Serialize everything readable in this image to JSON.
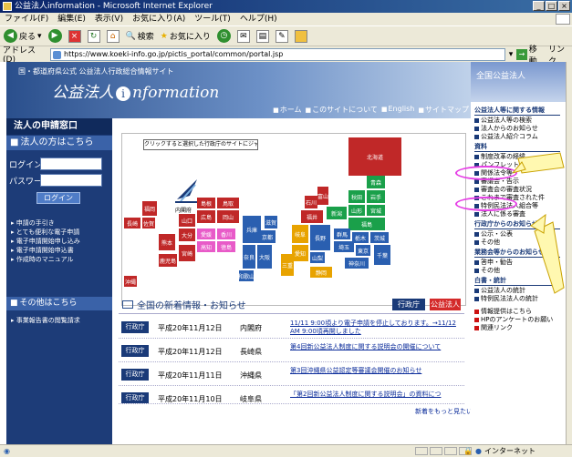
{
  "window": {
    "title": "公益法人information - Microsoft Internet Explorer",
    "controls": [
      "_",
      "□",
      "×"
    ]
  },
  "menu": [
    "ファイル(F)",
    "編集(E)",
    "表示(V)",
    "お気に入り(A)",
    "ツール(T)",
    "ヘルプ(H)"
  ],
  "toolbar": {
    "back": "戻る",
    "search": "検索",
    "favorites": "お気に入り"
  },
  "address": {
    "label": "アドレス(D)",
    "url": "https://www.koeki-info.go.jp/pictis_portal/common/portal.jsp",
    "go": "移動",
    "links": "リンク"
  },
  "header": {
    "subtitle": "国・都道府県公式 公益法人行政総合情報サイト",
    "logo_prefix": "公益法人",
    "logo_mark": "i",
    "logo_suffix": "nformation",
    "nav": [
      "ホーム",
      "このサイトについて",
      "English",
      "サイトマップ"
    ]
  },
  "left": {
    "title": "法人の申請窓口",
    "section": "法人の方はこちら",
    "login_id_label": "ログインID",
    "password_label": "パスワード",
    "login_button": "ログイン",
    "links": [
      "申請の手引き",
      "とても便利な電子申請",
      "電子申請開始申し込み",
      "電子申請開始申込書",
      "作成時のマニュアル"
    ],
    "other_section": "その他はこちら",
    "other_links": [
      "事業報告書の閲覧請求"
    ]
  },
  "map": {
    "hint": "クリックすると選択した行政庁のサイトにジャンプします",
    "cabinet_label": "内閣府",
    "prefectures": [
      {
        "name": "北海道",
        "color": "#c02828"
      },
      {
        "name": "青森",
        "color": "#1aa04a"
      },
      {
        "name": "秋田",
        "color": "#1aa04a"
      },
      {
        "name": "岩手",
        "color": "#1aa04a"
      },
      {
        "name": "山形",
        "color": "#1aa04a"
      },
      {
        "name": "宮城",
        "color": "#1aa04a"
      },
      {
        "name": "石川",
        "color": "#c02828"
      },
      {
        "name": "新潟",
        "color": "#1aa04a"
      },
      {
        "name": "福島",
        "color": "#1aa04a"
      },
      {
        "name": "富山",
        "color": "#c02828"
      },
      {
        "name": "福井",
        "color": "#c02828"
      },
      {
        "name": "長野",
        "color": "#2a5fb0"
      },
      {
        "name": "群馬",
        "color": "#2a5fb0"
      },
      {
        "name": "栃木",
        "color": "#2a5fb0"
      },
      {
        "name": "茨城",
        "color": "#2a5fb0"
      },
      {
        "name": "埼玉",
        "color": "#2a5fb0"
      },
      {
        "name": "東京",
        "color": "#2a5fb0"
      },
      {
        "name": "千葉",
        "color": "#2a5fb0"
      },
      {
        "name": "神奈川",
        "color": "#2a5fb0"
      },
      {
        "name": "山梨",
        "color": "#2a5fb0"
      },
      {
        "name": "岐阜",
        "color": "#e8a300"
      },
      {
        "name": "静岡",
        "color": "#e8a300"
      },
      {
        "name": "愛知",
        "color": "#e8a300"
      },
      {
        "name": "三重",
        "color": "#e8a300"
      },
      {
        "name": "滋賀",
        "color": "#2a5fb0"
      },
      {
        "name": "京都",
        "color": "#2a5fb0"
      },
      {
        "name": "大阪",
        "color": "#2a5fb0"
      },
      {
        "name": "兵庫",
        "color": "#2a5fb0"
      },
      {
        "name": "奈良",
        "color": "#2a5fb0"
      },
      {
        "name": "和歌山",
        "color": "#2a5fb0"
      },
      {
        "name": "鳥取",
        "color": "#c02828"
      },
      {
        "name": "島根",
        "color": "#c02828"
      },
      {
        "name": "岡山",
        "color": "#c02828"
      },
      {
        "name": "広島",
        "color": "#c02828"
      },
      {
        "name": "山口",
        "color": "#c02828"
      },
      {
        "name": "香川",
        "color": "#e85ac8"
      },
      {
        "name": "愛媛",
        "color": "#e85ac8"
      },
      {
        "name": "徳島",
        "color": "#e85ac8"
      },
      {
        "name": "高知",
        "color": "#e85ac8"
      },
      {
        "name": "福岡",
        "color": "#c02828"
      },
      {
        "name": "佐賀",
        "color": "#c02828"
      },
      {
        "name": "長崎",
        "color": "#c02828"
      },
      {
        "name": "大分",
        "color": "#c02828"
      },
      {
        "name": "熊本",
        "color": "#c02828"
      },
      {
        "name": "宮崎",
        "color": "#c02828"
      },
      {
        "name": "鹿児島",
        "color": "#c02828"
      },
      {
        "name": "沖縄",
        "color": "#c02828"
      }
    ]
  },
  "news": {
    "title": "全国の新着情報・お知らせ",
    "btn_gov": "行政庁",
    "btn_corp": "公益法人",
    "rows": [
      {
        "tag": "行政庁",
        "date": "平成20年11月12日",
        "src": "内閣府",
        "title": "11/11 9:00頃より電子申請を停止しております。→11/12 AM 9:00頃再開しました"
      },
      {
        "tag": "行政庁",
        "date": "平成20年11月12日",
        "src": "長崎県",
        "title": "第4回新公益法人制度に関する説明会の開催について"
      },
      {
        "tag": "行政庁",
        "date": "平成20年11月11日",
        "src": "沖縄県",
        "title": "第3回沖縄県公益認定等審議会開催のお知らせ"
      },
      {
        "tag": "行政庁",
        "date": "平成20年11月10日",
        "src": "岐阜県",
        "title": "「第2回新公益法人制度に関する説明会」の資料につ"
      }
    ],
    "more": "新着をもっと見たい"
  },
  "right": {
    "top": "全国公益法人",
    "sections": [
      {
        "title": "公益法人等に関する情報",
        "items": [
          "公益法人等の検索",
          "法人からのお知らせ",
          "公益法人紹介コラム"
        ]
      },
      {
        "title": "資料",
        "items": [
          "制度改革の経緯",
          "パンフレット",
          "関係法令等",
          "審議会・告示",
          "審査会の審査状況",
          "これまで審査された件",
          "特例民法法人組合等",
          "法人に係る審査"
        ]
      },
      {
        "title": "行政庁からのお知らせ",
        "items": [
          "公示・公表",
          "その他"
        ]
      },
      {
        "title": "業務会等からのお知らせ",
        "items": [
          "答申・勧告",
          "その他"
        ]
      },
      {
        "title": "白書・統計",
        "items": [
          "公益法人の統計",
          "特例民法法人の統計"
        ]
      },
      {
        "title": "",
        "items": [
          "情報提供はこちら",
          "HPのアンケートのお願い",
          "関連リンク"
        ]
      }
    ]
  },
  "status": {
    "zone": "インターネット"
  }
}
